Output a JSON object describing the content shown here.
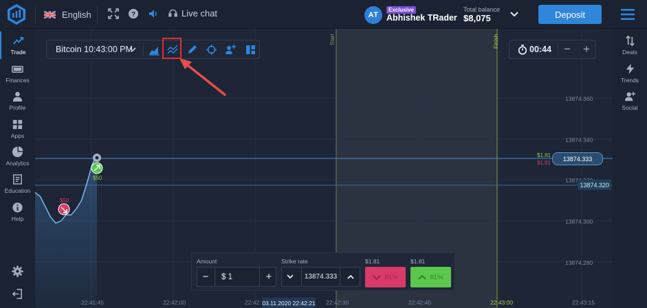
{
  "header": {
    "language": "English",
    "live_chat": "Live chat",
    "user": {
      "initials": "AT",
      "badge": "Exclusive",
      "name": "Abhishek TRader"
    },
    "balance": {
      "label": "Total balance",
      "value": "$8,075"
    },
    "deposit_label": "Deposit"
  },
  "sidebar_left": {
    "items": [
      {
        "label": "Trade",
        "icon": "trade-icon",
        "active": true
      },
      {
        "label": "Finances",
        "icon": "finances-icon"
      },
      {
        "label": "Profile",
        "icon": "profile-icon"
      },
      {
        "label": "Apps",
        "icon": "apps-icon"
      },
      {
        "label": "Analytics",
        "icon": "analytics-icon"
      },
      {
        "label": "Education",
        "icon": "education-icon"
      },
      {
        "label": "Help",
        "icon": "help-icon"
      }
    ]
  },
  "sidebar_right": {
    "items": [
      {
        "label": "Deals",
        "icon": "deals-icon"
      },
      {
        "label": "Trends",
        "icon": "trends-icon"
      },
      {
        "label": "Social",
        "icon": "social-icon"
      }
    ]
  },
  "toolbar": {
    "asset": "Bitcoin 10:43:00 PM",
    "timer": "00:44",
    "timer_minus": "−",
    "timer_plus": "+"
  },
  "chart_data": {
    "type": "line",
    "price_labels": [
      "13874.360",
      "13874.340",
      "13874.320",
      "13874.300",
      "13874.280"
    ],
    "current_price": "13874.333",
    "strike_price": "13874.320",
    "time_labels": [
      "22:41:45",
      "22:42:00",
      "22:42:",
      "22:42:30",
      "22:42:45",
      "22:43:00",
      "22:43:15"
    ],
    "cursor_date": "03.11.2020 22:42:21",
    "start_label": "Start",
    "finish_label": "Finish",
    "payouts": {
      "up": "$1.81",
      "down": "$1.81"
    },
    "trades": [
      {
        "direction": "down",
        "amount": "$50"
      },
      {
        "direction": "up",
        "amount": "$50"
      }
    ],
    "series": [
      {
        "values": [
          13874.314,
          13874.312,
          13874.307,
          13874.302,
          13874.299,
          13874.3,
          13874.303,
          13874.303,
          13874.306,
          13874.31,
          13874.318,
          13874.327,
          13874.333
        ]
      }
    ]
  },
  "trade_panel": {
    "amount_label": "Amount",
    "amount_value": "$ 1",
    "strike_label": "Strike rate",
    "strike_value": "13874.333",
    "down_payout": "$1.81",
    "up_payout": "$1.81",
    "down_percent": "81%",
    "up_percent": "81%",
    "minus": "−",
    "plus": "+"
  }
}
